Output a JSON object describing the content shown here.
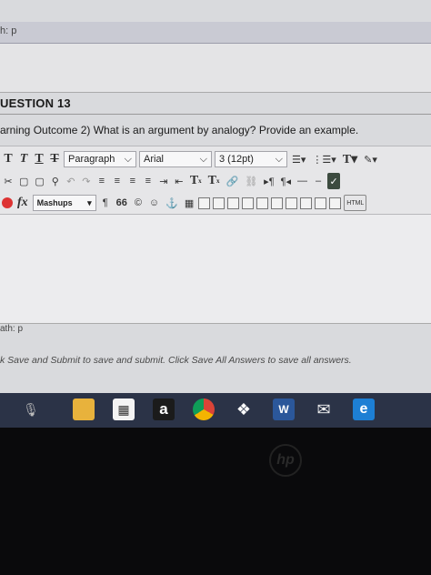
{
  "top_path": "h: p",
  "question": {
    "title": "UESTION 13",
    "text": "arning Outcome 2) What is an argument by analogy? Provide an example."
  },
  "toolbar": {
    "text_styles": [
      "T",
      "T",
      "T",
      "T"
    ],
    "paragraph_select": "Paragraph",
    "font_select": "Arial",
    "size_select": "3 (12pt)",
    "mashups_label": "Mashups",
    "quote_label": "66",
    "html_label": "HTML",
    "fx_label": "fx",
    "superscript": "T",
    "subscript": "T"
  },
  "bottom_path": "ath: p",
  "instruction": "k Save and Submit to save and submit. Click Save All Answers to save all answers.",
  "taskbar": {
    "amazon_letter": "a",
    "word_letter": "W"
  },
  "bezel_logo": "hp",
  "colors": {
    "screen_bg": "#d9dadd",
    "taskbar_bg": "#2b3347",
    "accent_blue": "#1d7fd4"
  }
}
